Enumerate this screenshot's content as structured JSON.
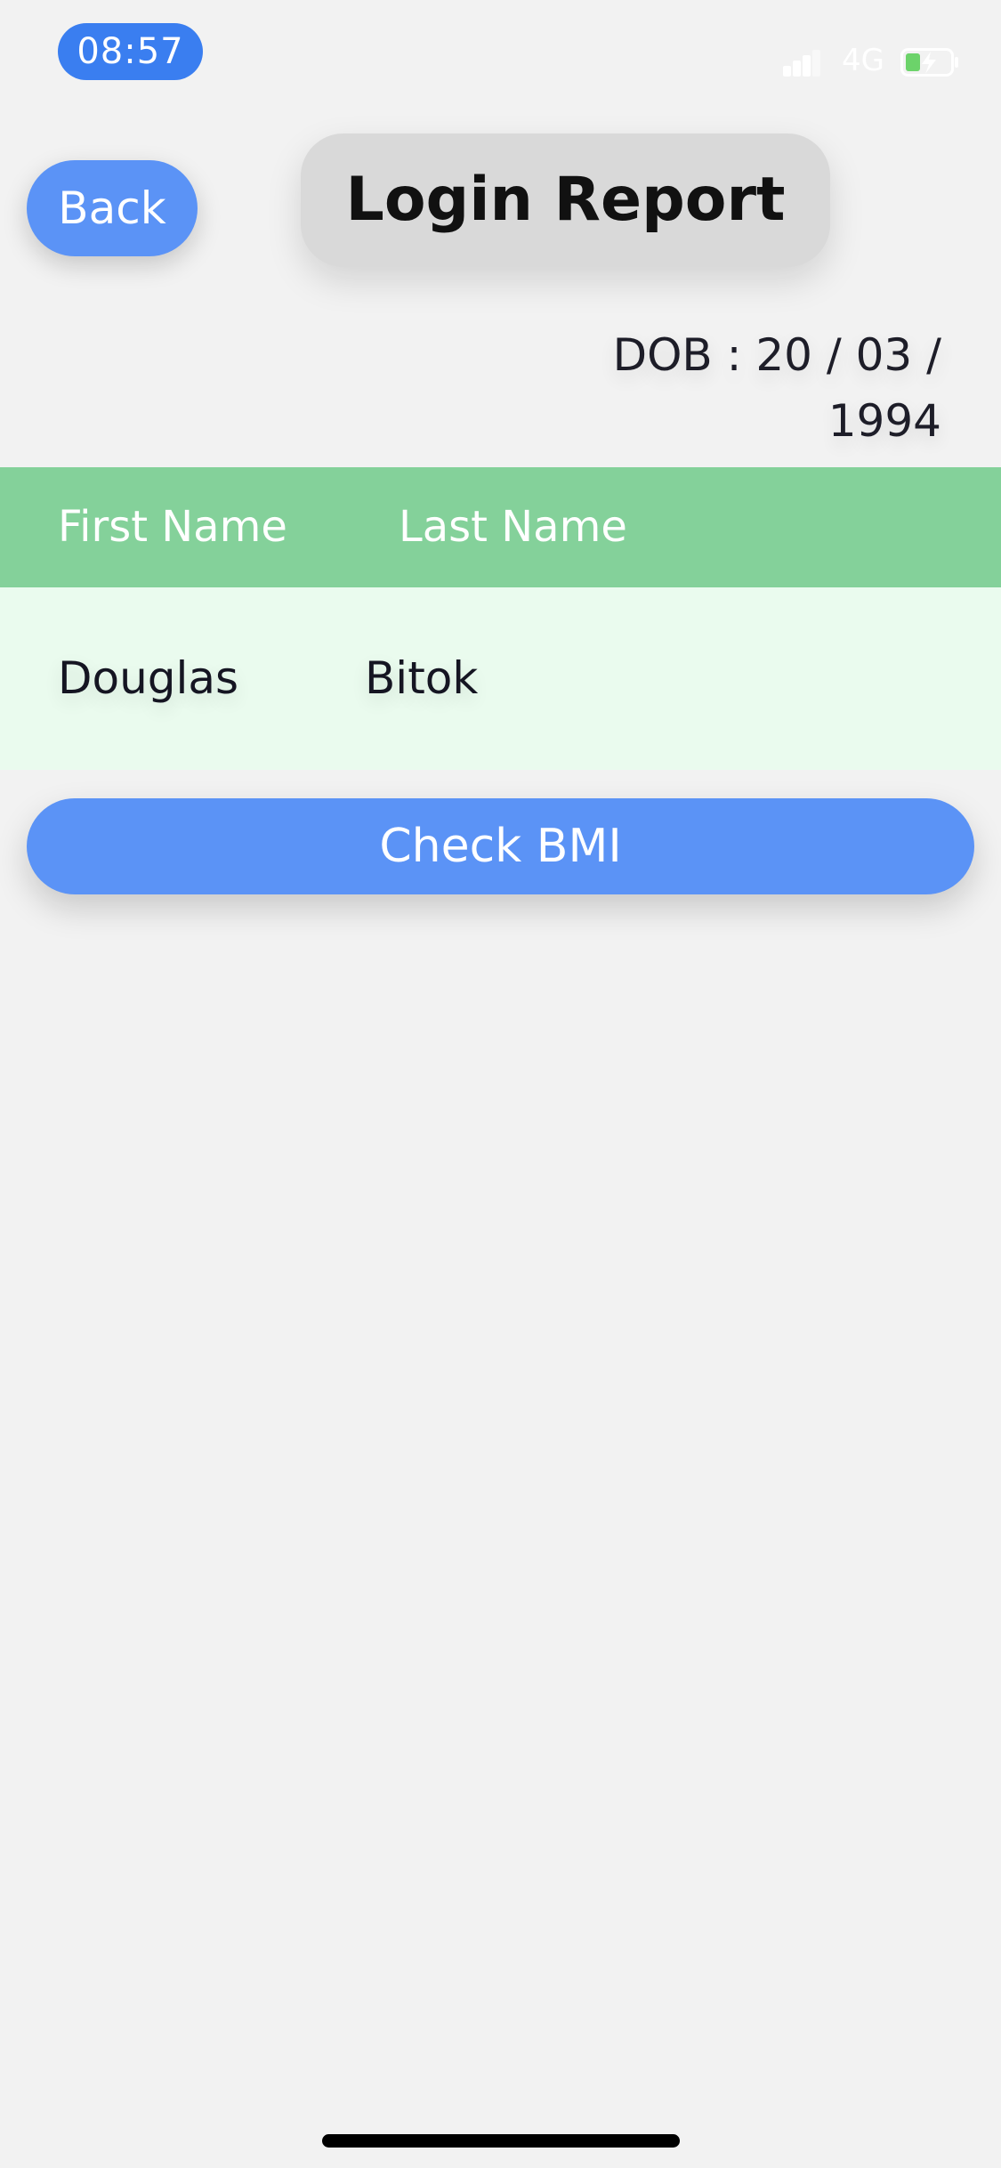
{
  "status_bar": {
    "time": "08:57",
    "network": "4G",
    "icons": [
      "signal-icon",
      "battery-charging-icon"
    ]
  },
  "header": {
    "back_label": "Back",
    "title": "Login Report"
  },
  "dob": {
    "text": "DOB : 20 / 03 / 1994"
  },
  "table": {
    "columns": [
      "First Name",
      "Last Name"
    ],
    "rows": [
      [
        "Douglas",
        "Bitok"
      ]
    ]
  },
  "actions": {
    "check_bmi_label": "Check BMI"
  },
  "colors": {
    "background": "#f2f2f2",
    "accent_blue": "#5b93f6",
    "time_pill": "#3a7ef0",
    "header_green": "#84d19a",
    "row_mint": "#eafbee",
    "title_card": "#d9d9d9"
  }
}
